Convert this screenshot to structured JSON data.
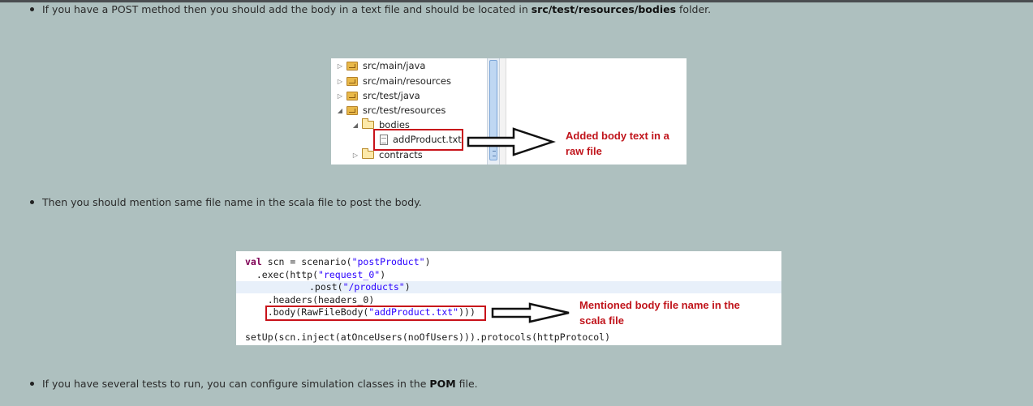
{
  "bullets": {
    "b1_text": "If you have a POST method then you should add the body in a text file and should be located in ",
    "b1_bold": "src/test/resources/bodies",
    "b1_tail": " folder.",
    "b2_text": "Then you should mention same file name in the scala file to post the body.",
    "b3_text": "If you have several tests to run, you can configure simulation classes in the ",
    "b3_bold": "POM",
    "b3_tail": " file."
  },
  "tree": {
    "items": [
      {
        "label": "src/main/java"
      },
      {
        "label": "src/main/resources"
      },
      {
        "label": "src/test/java"
      },
      {
        "label": "src/test/resources"
      },
      {
        "label": "bodies"
      },
      {
        "label": "addProduct.txt"
      },
      {
        "label": "contracts"
      }
    ],
    "annotation_line1": "Added body text in a",
    "annotation_line2": "raw file"
  },
  "code": {
    "lines": [
      "val scn = scenario(\"postProduct\")",
      "  .exec(http(\"request_0\")",
      "    .post(\"/products\")",
      "    .headers(headers_0)",
      "    .body(RawFileBody(\"addProduct.txt\")))",
      "",
      "setUp(scn.inject(atOnceUsers(noOfUsers))).protocols(httpProtocol)"
    ],
    "annotation_line1": "Mentioned body file name in the",
    "annotation_line2": "scala file"
  },
  "colors": {
    "background": "#aec0bf",
    "annotation": "#c0141b",
    "keyword": "#7f0055",
    "string": "#2a00ff"
  }
}
